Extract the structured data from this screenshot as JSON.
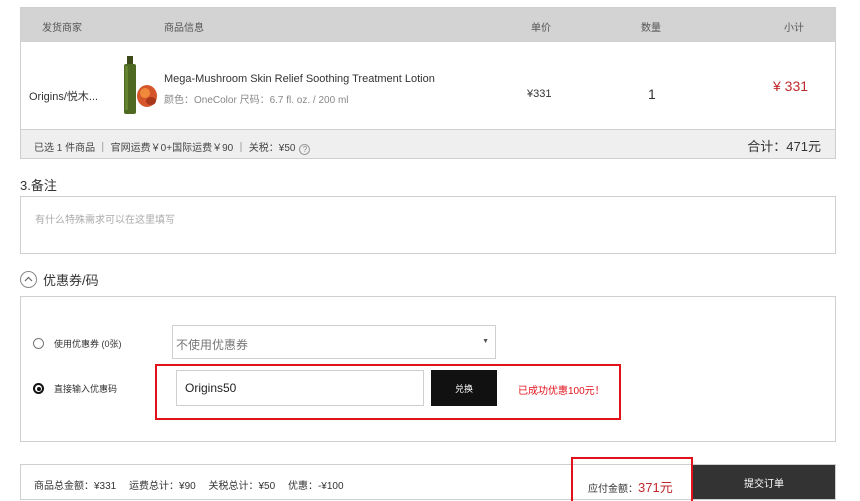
{
  "table": {
    "headers": {
      "seller": "发货商家",
      "product": "商品信息",
      "unit_price": "单价",
      "quantity": "数量",
      "subtotal": "小计"
    },
    "item": {
      "seller": "Origins/悦木...",
      "name": "Mega-Mushroom Skin Relief Soothing Treatment Lotion",
      "meta": "颜色：OneColor 尺码：6.7 fl. oz. / 200 ml",
      "unit_price": "¥331",
      "quantity": "1",
      "subtotal": "¥ 331"
    },
    "summary": {
      "text": "已选 1 件商品 ｜ 官网运费￥0+国际运费￥90 ｜ 关税：¥50",
      "help_icon": "?",
      "total": "合计：471元"
    }
  },
  "notes": {
    "label": "3.备注",
    "placeholder": "有什么特殊需求可以在这里填写"
  },
  "coupon": {
    "toggle_label": "优惠券/码",
    "toggle_icon": "chevron-up-icon",
    "use_coupon_label": "使用优惠券 (0张)",
    "select_value": "不使用优惠券",
    "direct_code_label": "直接输入优惠码",
    "code_value": "Origins50",
    "exchange_label": "兑换",
    "success_msg": "已成功优惠100元！"
  },
  "footer": {
    "goods_total": "商品总金额：¥331",
    "shipping_total": "运费总计：¥90",
    "tax_total": "关税总计：¥50",
    "discount": "优惠：-¥100",
    "payable_label": "应付金额：",
    "payable_amount": "371元",
    "submit_label": "提交订单"
  },
  "colors": {
    "accent_red": "#e1121b",
    "price_red": "#c0292d",
    "dark": "#333333"
  }
}
